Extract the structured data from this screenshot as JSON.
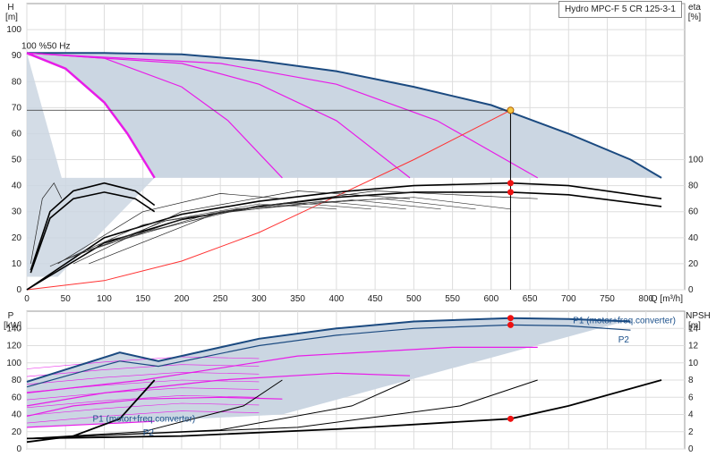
{
  "title": "Hydro MPC-F 5 CR 125-3-1",
  "colors": {
    "area": "#cbd6e2",
    "main": "#1b4a80",
    "pink": "#e81ce8",
    "sys": "#ff3333",
    "marker": "#ee1111",
    "dutyFill": "#f5c842"
  },
  "chart_data": [
    {
      "type": "line",
      "id": "head_efficiency",
      "xlabel": "Q [m³/h]",
      "ylabel_left": [
        "H",
        "[m]"
      ],
      "ylabel_right": [
        "eta",
        "[%]"
      ],
      "xlim": [
        0,
        850
      ],
      "ylim": [
        0,
        110
      ],
      "xticks": [
        0,
        50,
        100,
        150,
        200,
        250,
        300,
        350,
        400,
        450,
        500,
        550,
        600,
        650,
        700,
        750,
        800
      ],
      "yticks": [
        0,
        10,
        20,
        30,
        40,
        50,
        60,
        70,
        80,
        90,
        100
      ],
      "yticks_right": [
        0,
        20,
        40,
        60,
        80,
        100
      ],
      "annotation": "100 %50 Hz",
      "duty_point": {
        "q": 625,
        "h": 69
      },
      "efficiency_markers": [
        {
          "q": 625,
          "eta": 82
        },
        {
          "q": 625,
          "eta": 75
        }
      ],
      "series": [
        {
          "role": "main",
          "x": [
            0,
            100,
            200,
            300,
            400,
            500,
            600,
            700,
            780,
            820
          ],
          "y": [
            91,
            91,
            90.5,
            88,
            84,
            78,
            71,
            60,
            50,
            43
          ]
        },
        {
          "role": "pink",
          "x": [
            0,
            50,
            100,
            130,
            165
          ],
          "y": [
            91,
            85,
            72,
            60,
            43
          ]
        },
        {
          "role": "pink",
          "x": [
            0,
            100,
            200,
            260,
            330
          ],
          "y": [
            91,
            89,
            78,
            65,
            43
          ]
        },
        {
          "role": "pink",
          "x": [
            0,
            200,
            300,
            400,
            495
          ],
          "y": [
            91,
            87,
            79,
            65,
            43
          ]
        },
        {
          "role": "pink",
          "x": [
            0,
            250,
            400,
            530,
            660
          ],
          "y": [
            91,
            87,
            79,
            65,
            43
          ]
        },
        {
          "role": "system",
          "x": [
            0,
            100,
            200,
            300,
            400,
            500,
            625
          ],
          "y": [
            0,
            3.5,
            11,
            22,
            36,
            50,
            69
          ]
        },
        {
          "role": "eta",
          "x": [
            0,
            100,
            200,
            300,
            400,
            500,
            625,
            700,
            820
          ],
          "y": [
            0,
            40,
            58,
            68,
            75,
            80,
            82,
            80,
            70
          ]
        },
        {
          "role": "eta",
          "x": [
            0,
            100,
            200,
            300,
            400,
            500,
            625,
            700,
            820
          ],
          "y": [
            0,
            36,
            54,
            64,
            71,
            75,
            75,
            73,
            64
          ]
        },
        {
          "role": "eta",
          "x": [
            5,
            30,
            60,
            100,
            140,
            165
          ],
          "y": [
            15,
            60,
            76,
            82,
            76,
            65
          ]
        },
        {
          "role": "eta",
          "x": [
            5,
            30,
            60,
            100,
            140,
            165
          ],
          "y": [
            13,
            55,
            70,
            75,
            70,
            60
          ]
        },
        {
          "role": "eta_thin",
          "x": [
            5,
            20,
            35,
            45
          ],
          "y": [
            20,
            70,
            82,
            70
          ]
        },
        {
          "role": "eta_thin",
          "x": [
            40,
            150,
            250,
            330
          ],
          "y": [
            20,
            60,
            74,
            70
          ]
        },
        {
          "role": "eta_thin",
          "x": [
            60,
            200,
            350,
            495
          ],
          "y": [
            20,
            60,
            76,
            70
          ]
        },
        {
          "role": "eta_thin",
          "x": [
            80,
            250,
            450,
            660
          ],
          "y": [
            20,
            60,
            76,
            70
          ]
        }
      ]
    },
    {
      "type": "line",
      "id": "power_npsh",
      "ylabel_left": [
        "P",
        "[kW]"
      ],
      "ylabel_right": [
        "NPSH",
        "[m]"
      ],
      "xlim": [
        0,
        850
      ],
      "ylim": [
        0,
        160
      ],
      "yticks": [
        0,
        20,
        40,
        60,
        80,
        100,
        120,
        140
      ],
      "yticks_right": [
        0,
        2,
        4,
        6,
        8,
        10,
        12,
        14
      ],
      "labels": [
        {
          "text": "P1 (motor+freq.converter)",
          "anchor": "end"
        },
        {
          "text": "P2",
          "anchor": "end"
        },
        {
          "text": "P1 (motor+freq.converter)",
          "anchor": "start"
        },
        {
          "text": "P2",
          "anchor": "start"
        }
      ],
      "markers": [
        {
          "q": 625,
          "p": 152
        },
        {
          "q": 625,
          "p": 144
        },
        {
          "q": 625,
          "p": 35
        }
      ],
      "series": [
        {
          "role": "main",
          "name": "P1 (motor+freq.converter)",
          "x": [
            0,
            120,
            170,
            300,
            400,
            500,
            625,
            700,
            780
          ],
          "y": [
            78,
            112,
            102,
            128,
            140,
            148,
            152,
            151,
            148
          ]
        },
        {
          "role": "main_thin",
          "name": "P2",
          "x": [
            0,
            120,
            170,
            300,
            400,
            500,
            625,
            700,
            780
          ],
          "y": [
            72,
            102,
            96,
            120,
            132,
            140,
            144,
            143,
            138
          ]
        },
        {
          "role": "pink",
          "x": [
            0,
            165
          ],
          "y": [
            25,
            32
          ]
        },
        {
          "role": "pink",
          "x": [
            0,
            60,
            150,
            250,
            330
          ],
          "y": [
            38,
            50,
            58,
            60,
            58
          ]
        },
        {
          "role": "pink",
          "x": [
            0,
            100,
            250,
            400,
            495
          ],
          "y": [
            50,
            65,
            80,
            88,
            85
          ]
        },
        {
          "role": "pink",
          "x": [
            0,
            150,
            350,
            550,
            660
          ],
          "y": [
            65,
            80,
            108,
            118,
            118
          ]
        },
        {
          "role": "npsh",
          "x": [
            0,
            200,
            400,
            625,
            700,
            820
          ],
          "y": [
            1.2,
            1.5,
            2.3,
            3.5,
            5,
            8
          ]
        },
        {
          "role": "npsh",
          "x": [
            0,
            60,
            120,
            165
          ],
          "y": [
            0.8,
            1.5,
            3.5,
            8
          ]
        },
        {
          "role": "npsh_thin",
          "x": [
            0,
            150,
            280,
            330
          ],
          "y": [
            1.2,
            2,
            5,
            8
          ]
        },
        {
          "role": "npsh_thin",
          "x": [
            0,
            250,
            420,
            495
          ],
          "y": [
            1.2,
            2.2,
            5,
            8
          ]
        },
        {
          "role": "npsh_thin",
          "x": [
            0,
            350,
            560,
            660
          ],
          "y": [
            1.2,
            2.5,
            5,
            8
          ]
        }
      ]
    }
  ]
}
